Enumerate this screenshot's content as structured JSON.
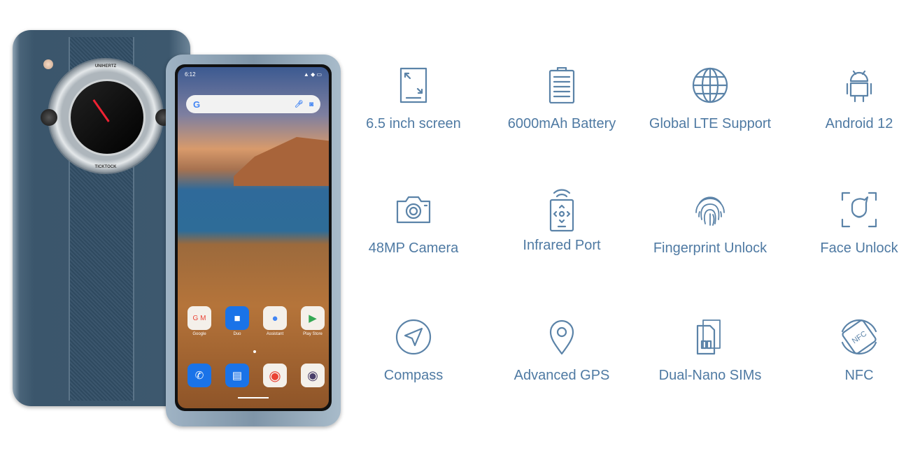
{
  "phone": {
    "watch_brand_top": "UNIHERTZ",
    "watch_brand_bottom": "TICKTOCK",
    "status_time": "6:12",
    "google_logo": "G",
    "apps_row1": [
      {
        "label": "Google",
        "icon": "google-folder-icon"
      },
      {
        "label": "Duo",
        "icon": "duo-icon"
      },
      {
        "label": "Assistant",
        "icon": "assistant-icon"
      },
      {
        "label": "Play Store",
        "icon": "play-store-icon"
      }
    ],
    "dock": [
      {
        "icon": "phone-icon"
      },
      {
        "icon": "messages-icon"
      },
      {
        "icon": "chrome-icon"
      },
      {
        "icon": "camera-app-icon"
      }
    ]
  },
  "accent_color": "#4f7aa3",
  "features": [
    {
      "label": "6.5 inch screen",
      "icon": "screen-size-icon"
    },
    {
      "label": "6000mAh Battery",
      "icon": "battery-icon"
    },
    {
      "label": "Global LTE Support",
      "icon": "globe-icon"
    },
    {
      "label": "Android 12",
      "icon": "android-icon"
    },
    {
      "label": "48MP Camera",
      "icon": "camera-icon"
    },
    {
      "label": "Infrared Port",
      "icon": "infrared-remote-icon"
    },
    {
      "label": "Fingerprint Unlock",
      "icon": "fingerprint-icon"
    },
    {
      "label": "Face Unlock",
      "icon": "face-unlock-icon"
    },
    {
      "label": "Compass",
      "icon": "compass-icon"
    },
    {
      "label": "Advanced GPS",
      "icon": "location-pin-icon"
    },
    {
      "label": "Dual-Nano SIMs",
      "icon": "sim-card-icon"
    },
    {
      "label": "NFC",
      "icon": "nfc-icon"
    }
  ]
}
